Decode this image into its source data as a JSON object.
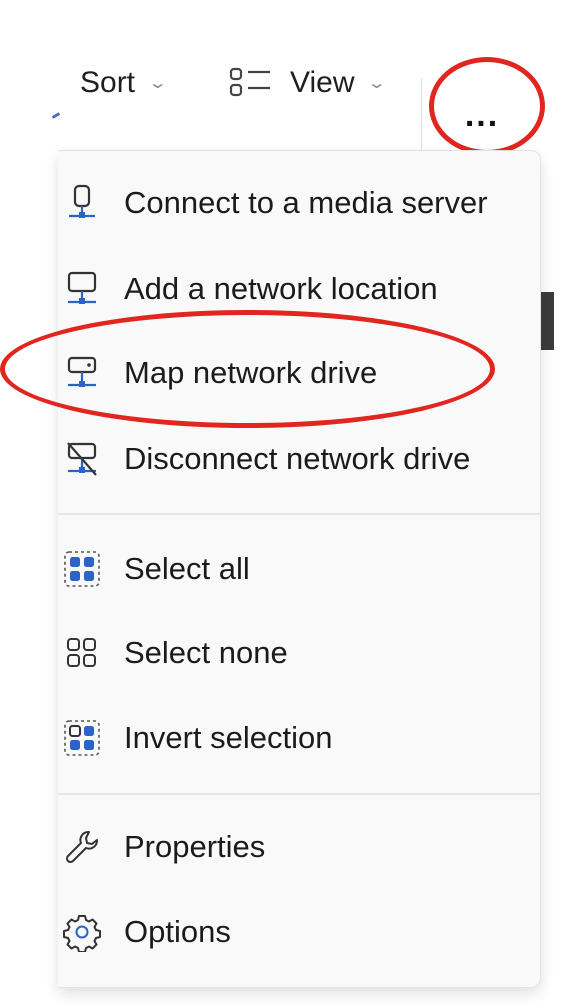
{
  "toolbar": {
    "sort_label": "Sort",
    "view_label": "View",
    "more_label": "...",
    "caret_glyph": "⌄"
  },
  "menu": {
    "groups": [
      {
        "items": [
          {
            "label": "Connect to a media server",
            "icon": "media-server-icon"
          },
          {
            "label": "Add a network location",
            "icon": "network-location-icon"
          },
          {
            "label": "Map network drive",
            "icon": "map-network-drive-icon"
          },
          {
            "label": "Disconnect network drive",
            "icon": "disconnect-network-drive-icon"
          }
        ]
      },
      {
        "items": [
          {
            "label": "Select all",
            "icon": "select-all-icon"
          },
          {
            "label": "Select none",
            "icon": "select-none-icon"
          },
          {
            "label": "Invert selection",
            "icon": "invert-selection-icon"
          }
        ]
      },
      {
        "items": [
          {
            "label": "Properties",
            "icon": "wrench-icon"
          },
          {
            "label": "Options",
            "icon": "gear-icon"
          }
        ]
      }
    ]
  },
  "colors": {
    "annotation_red": "#e0261e",
    "icon_blue": "#2b63c6",
    "menu_bg": "#f9f9f9"
  }
}
